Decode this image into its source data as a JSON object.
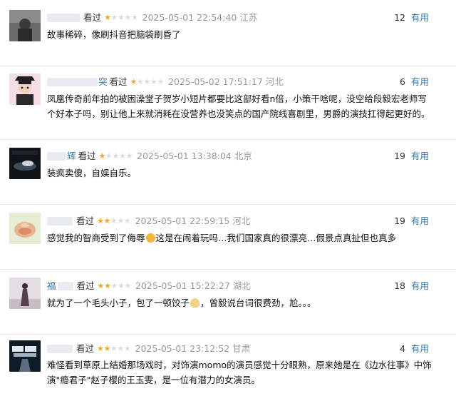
{
  "comments": [
    {
      "user": "看过",
      "rating": 1,
      "time": "2025-05-01 22:54:40",
      "location": "江苏",
      "votes": "12",
      "useful_label": "有用",
      "text": "故事稀碎，像刷抖音把脑袋刷昏了"
    },
    {
      "user": "看过",
      "user_tail": "突",
      "rating": 1,
      "time": "2025-05-02 17:51:17",
      "location": "河北",
      "votes": "6",
      "useful_label": "有用",
      "text": "凤凰传奇前年拍的被困澡堂子贺岁小短片都要比这部好看n倍，小策干啥呢，没空给段毅宏老师写个好本子吗，别让他上来就消耗在没营养也没笑点的国产院线喜剧里，男爵的演技扛得起更好的。"
    },
    {
      "user": "看过",
      "user_tail": "辉",
      "rating": 1,
      "time": "2025-05-01 13:38:04",
      "location": "北京",
      "votes": "19",
      "useful_label": "有用",
      "text": "装疯卖傻，自娱自乐。"
    },
    {
      "user": "看过",
      "rating": 2,
      "time": "2025-05-01 22:59:15",
      "location": "河北",
      "votes": "19",
      "useful_label": "有用",
      "text_a": "感觉我的智商受到了侮辱",
      "text_b": "这是在闹着玩吗…我们国家真的很漂亮…假景点真扯但也真多"
    },
    {
      "user": "看过",
      "user_head": "福",
      "rating": 2,
      "time": "2025-05-01 15:22:27",
      "location": "湖北",
      "votes": "18",
      "useful_label": "有用",
      "text_a": "就为了一个毛头小子，包了一顿饺子",
      "text_b": "，曾毅说台词很费劲，尬。。。"
    },
    {
      "user": "看过",
      "rating": 2,
      "time": "2025-05-01 23:12:52",
      "location": "甘肃",
      "votes": "4",
      "useful_label": "有用",
      "text": "难怪看到草原上结婚那场戏时，对饰演momo的演员感觉十分眼熟，原来她是在《边水往事》中饰演\"瘾君子\"赵子樱的王玉雯，是一位有潜力的女演员。"
    }
  ]
}
